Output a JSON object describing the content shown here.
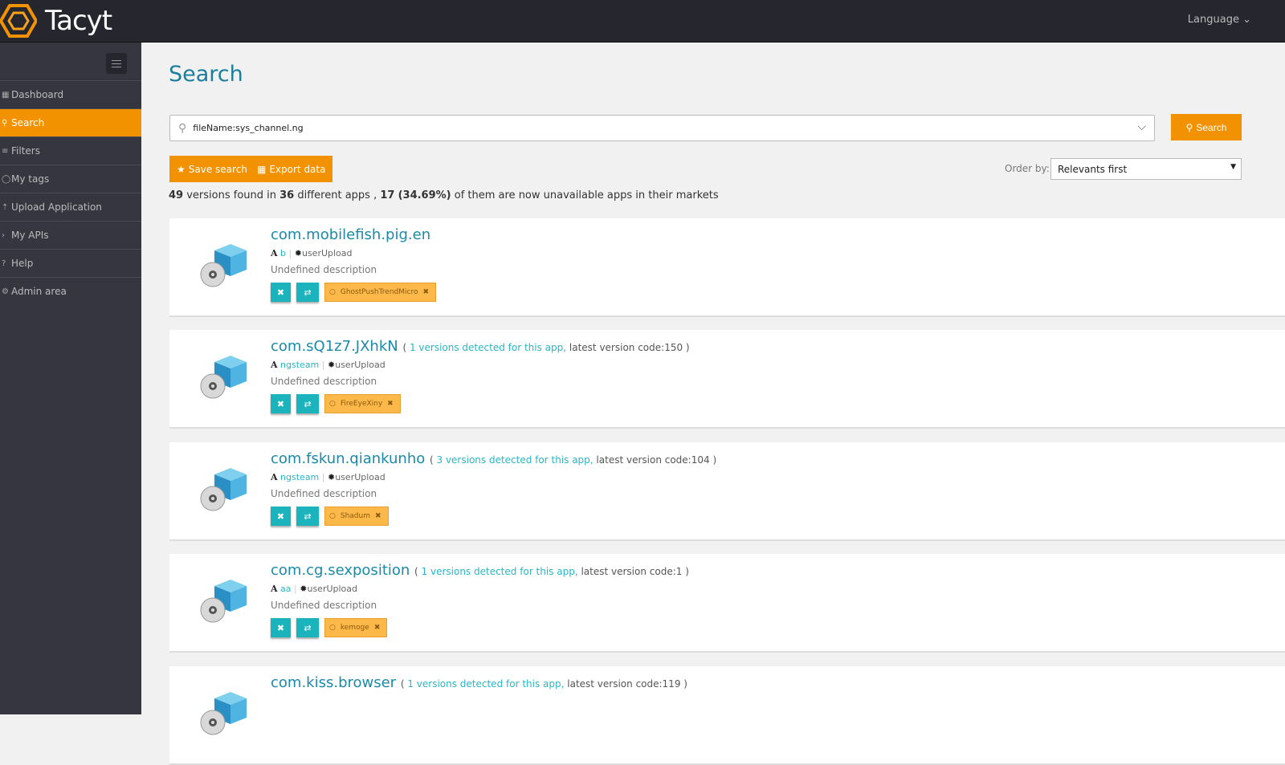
{
  "header": {
    "brand": "Tacyt",
    "language": "Language"
  },
  "sidebar": {
    "items": [
      {
        "label": "Dashboard",
        "icon": "dashboard-icon"
      },
      {
        "label": "Search",
        "icon": "search-icon",
        "active": true
      },
      {
        "label": "Filters",
        "icon": "filter-icon"
      },
      {
        "label": "My tags",
        "icon": "tag-icon"
      },
      {
        "label": "Upload Application",
        "icon": "upload-icon"
      },
      {
        "label": "My APIs",
        "icon": "chevron-right-icon"
      },
      {
        "label": "Help",
        "icon": "help-icon"
      },
      {
        "label": "Admin area",
        "icon": "gear-icon"
      }
    ]
  },
  "main": {
    "title": "Search",
    "query": "fileName:sys_channel.ng",
    "search_label": "Search",
    "save_label": "Save search",
    "export_label": "Export data",
    "order_label": "Order by:",
    "order_value": "Relevants first",
    "summary": {
      "versions": "49",
      "t1": " versions found in ",
      "apps": "36",
      "t2": " different apps , ",
      "unavail": "17",
      "pct": "(34.69%)",
      "t3": " of them are now unavailable apps in their markets"
    },
    "results": [
      {
        "name": "com.mobilefish.pig.en",
        "versions": "",
        "code": "",
        "author": "b",
        "source": "userUpload",
        "desc": "Undefined description",
        "tag": "GhostPushTrendMicro"
      },
      {
        "name": "com.sQ1z7.JXhkN",
        "versions": "1 versions detected for this app,",
        "code": " latest version code:150 )",
        "author": "ngsteam",
        "source": "userUpload",
        "desc": "Undefined description",
        "tag": "FireEyeXiny"
      },
      {
        "name": "com.fskun.qiankunho",
        "versions": "3 versions detected for this app,",
        "code": " latest version code:104 )",
        "author": "ngsteam",
        "source": "userUpload",
        "desc": "Undefined description",
        "tag": "Shadum"
      },
      {
        "name": "com.cg.sexposition",
        "versions": "1 versions detected for this app,",
        "code": " latest version code:1 )",
        "author": "aa",
        "source": "userUpload",
        "desc": "Undefined description",
        "tag": "kemoge"
      },
      {
        "name": "com.kiss.browser",
        "versions": "1 versions detected for this app,",
        "code": " latest version code:119 )",
        "author": "",
        "source": "",
        "desc": "",
        "tag": ""
      }
    ]
  }
}
